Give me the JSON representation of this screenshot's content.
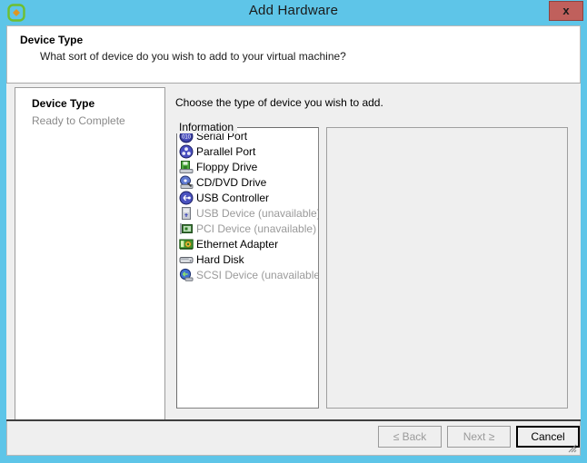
{
  "window": {
    "title": "Add Hardware",
    "app_icon": "vm-hardware-icon",
    "close_label": "x",
    "border_color": "#5ec5e8"
  },
  "header": {
    "title": "Device Type",
    "subtitle": "What sort of device do you wish to add to your virtual machine?"
  },
  "nav": {
    "items": [
      {
        "label": "Device Type",
        "state": "current"
      },
      {
        "label": "Ready to Complete",
        "state": "pending"
      }
    ]
  },
  "content": {
    "prompt": "Choose the type of device you wish to add.",
    "devices": [
      {
        "label": "Serial Port",
        "icon": "serial-port-icon",
        "disabled": false
      },
      {
        "label": "Parallel Port",
        "icon": "parallel-port-icon",
        "disabled": false
      },
      {
        "label": "Floppy Drive",
        "icon": "floppy-drive-icon",
        "disabled": false
      },
      {
        "label": "CD/DVD Drive",
        "icon": "cd-dvd-drive-icon",
        "disabled": false
      },
      {
        "label": "USB Controller",
        "icon": "usb-controller-icon",
        "disabled": false
      },
      {
        "label": "USB Device (unavailable)",
        "icon": "usb-device-icon",
        "disabled": true
      },
      {
        "label": "PCI Device (unavailable)",
        "icon": "pci-device-icon",
        "disabled": true
      },
      {
        "label": "Ethernet Adapter",
        "icon": "ethernet-adapter-icon",
        "disabled": false
      },
      {
        "label": "Hard Disk",
        "icon": "hard-disk-icon",
        "disabled": false
      },
      {
        "label": "SCSI Device (unavailable)",
        "icon": "scsi-device-icon",
        "disabled": true
      }
    ],
    "info_group_title": "Information",
    "info_body": ""
  },
  "footer": {
    "back_label": "≤ Back",
    "next_label": "Next ≥",
    "cancel_label": "Cancel",
    "back_disabled": true,
    "next_disabled": true
  }
}
